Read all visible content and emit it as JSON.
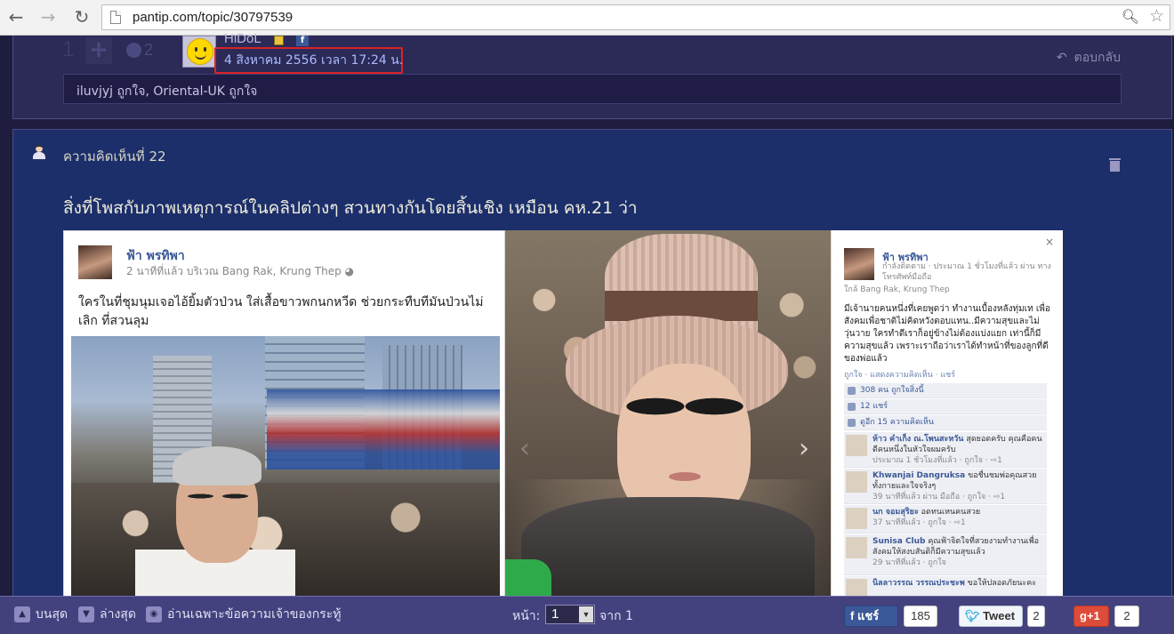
{
  "browser": {
    "url": "pantip.com/topic/30797539"
  },
  "comment21": {
    "vote_count": "1",
    "emotion_count": "2",
    "username": "HiDoL",
    "timestamp": "4 สิงหาคม 2556 เวลา 17:24 น.",
    "reply_label": "ตอบกลับ",
    "likers": "iluvjyj ถูกใจ, Oriental-UK ถูกใจ"
  },
  "comment22": {
    "header": "ความคิดเห็นที่ 22",
    "text": "สิ่งที่โพสกับภาพเหตุการณ์ในคลิปต่างๆ สวนทางกันโดยสิ้นเชิง เหมือน คห.21 ว่า"
  },
  "embedded_post": {
    "left": {
      "name": "ฟ้า พรทิพา",
      "meta": "2 นาทีที่แล้ว บริเวณ Bang Rak, Krung Thep",
      "caption": "ใครในที่ชุมนุมเจอไอ้ยิ้มตัวป่วน ใส่เสื้อขาวพกนกหวีด ช่วยกระทืบทีมันป่วนไม่เลิก ที่สวนลุม"
    },
    "right": {
      "name": "ฟ้า พรทิพา",
      "meta": "กำลังติดตาม · ประมาณ 1 ชั่วโมงที่แล้ว ผ่าน ทาง โทรศัพท์มือถือ",
      "location": "ใกล้ Bang Rak, Krung Thep",
      "text": "มีเจ้านายคนหนึ่งที่เคยพูดว่า ทำงานเบื้องหลังทุ่มเท เพื่อสังคมเพื่อชาติไม่คิดหวังตอบแทน..มีความสุขและไม่วุ่นวาย ใครทำดีเราก็อยู่ข้างไม่ต้องแบ่งแยก เท่านี้ก็มีความสุขแล้ว เพราะเราถือว่าเราได้ทำหน้าที่ของลูกที่ดีของพ่อแล้ว",
      "actions": "ถูกใจ · แสดงความคิดเห็น · แชร์",
      "likes": "308 คน ถูกใจสิ่งนี้",
      "shares": "12 แชร์",
      "comments_count": "ดูอีก 15 ความคิดเห็น",
      "comments": [
        {
          "who": "ห้าว คำเก็ง ณ.โพนสะหวัน",
          "text": "สุดยอดครับ คุณคือคนดีคนหนึ่งในหัวใจผมครับ",
          "when": "ประมาณ 1 ชั่วโมงที่แล้ว · ถูกใจ · ⇨1"
        },
        {
          "who": "Khwanjai Dangruksa",
          "text": "ขอชื่นชมพ่อคุณสวยทั้งกายและใจจริงๆ",
          "when": "39 นาทีที่แล้ว ผ่าน มือถือ · ถูกใจ · ⇨1"
        },
        {
          "who": "นก จอมสุริยะ",
          "text": "อดทนเหนคนสวย",
          "when": "37 นาทีที่แล้ว · ถูกใจ · ⇨1"
        },
        {
          "who": "Sunisa Club",
          "text": "คุณฟ้าจิตใจที่สวยงามทำงานเพื่อสังคมให้สงบสันติก็มีความสุขแล้ว",
          "when": "29 นาทีที่แล้ว · ถูกใจ"
        },
        {
          "who": "นิลลาวรรณ วรรณประชะพ",
          "text": "ขอให้ปลอดภัยนะคะ",
          "when": ""
        }
      ]
    }
  },
  "toolbar": {
    "top_label": "บนสุด",
    "bottom_label": "ล่างสุด",
    "owner_only_label": "อ่านเฉพาะข้อความเจ้าของกระทู้",
    "page_label": "หน้า:",
    "page_value": "1",
    "of_label": "จาก 1",
    "fb_share_label": "แชร์",
    "fb_share_count": "185",
    "tweet_label": "Tweet",
    "tweet_count": "2",
    "gplus_label": "+1",
    "gplus_count": "2"
  }
}
